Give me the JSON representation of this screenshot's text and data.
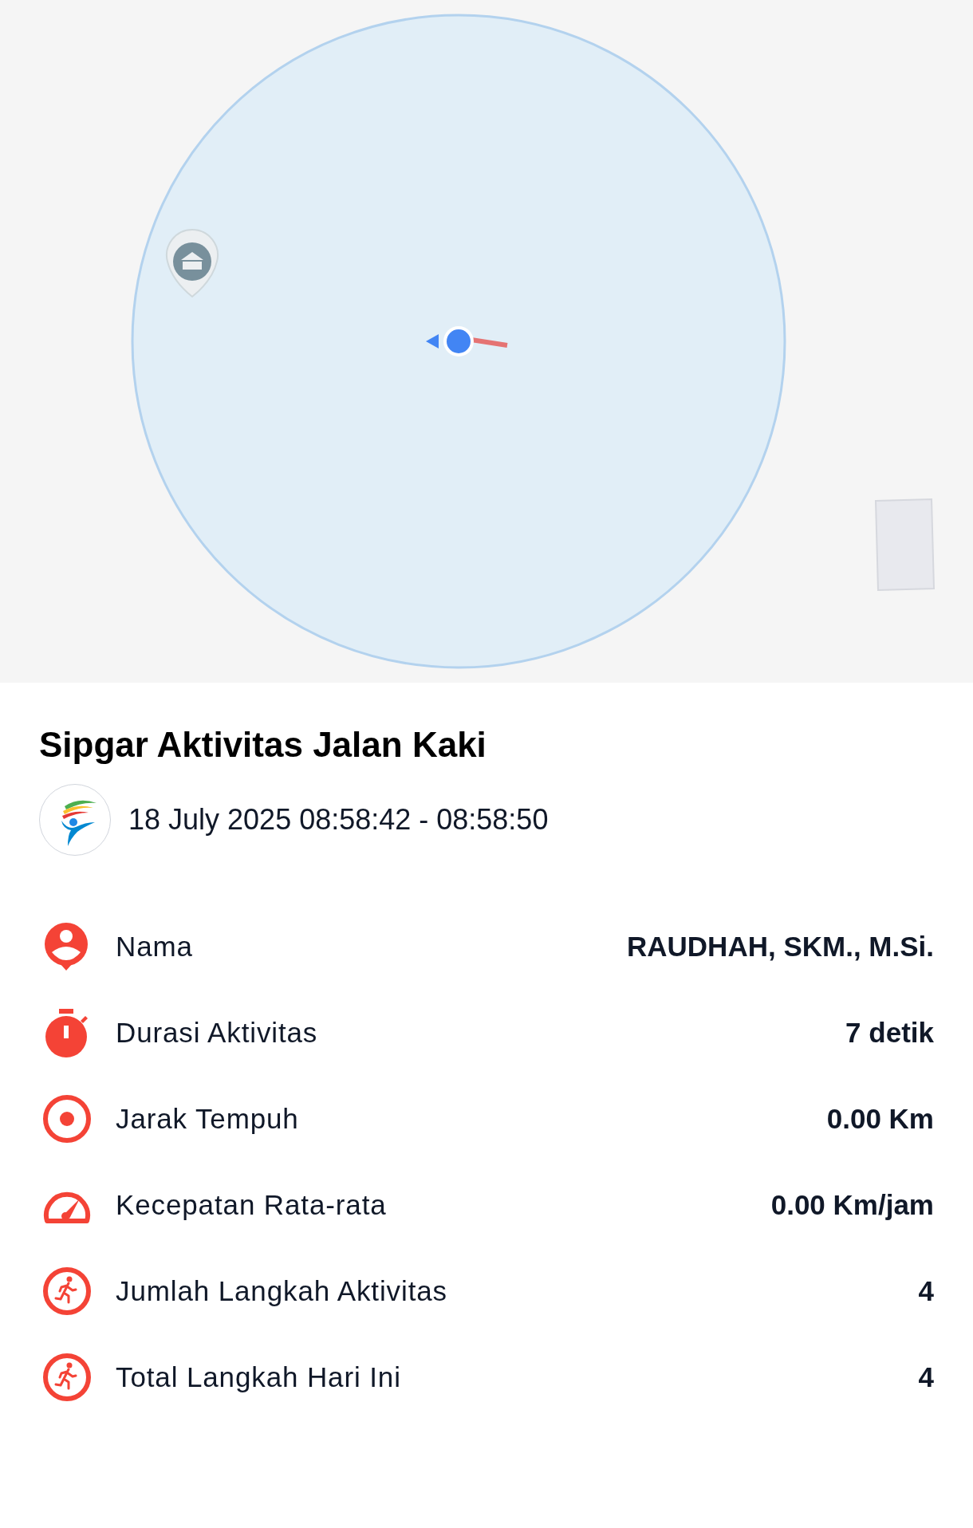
{
  "title": "Sipgar Aktivitas Jalan Kaki",
  "date_range": "18 July 2025 08:58:42 - 08:58:50",
  "stats": [
    {
      "kind": "person",
      "label": "Nama",
      "value": "RAUDHAH, SKM., M.Si."
    },
    {
      "kind": "timer",
      "label": "Durasi Aktivitas",
      "value": "7 detik"
    },
    {
      "kind": "target",
      "label": "Jarak Tempuh",
      "value": "0.00 Km"
    },
    {
      "kind": "speed",
      "label": "Kecepatan Rata-rata",
      "value": "0.00 Km/jam"
    },
    {
      "kind": "run",
      "label": "Jumlah Langkah Aktivitas",
      "value": "4"
    },
    {
      "kind": "run",
      "label": "Total Langkah Hari Ini",
      "value": "4"
    }
  ]
}
